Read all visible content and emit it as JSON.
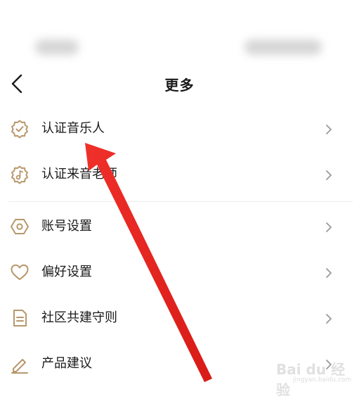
{
  "header": {
    "title": "更多"
  },
  "menu": {
    "items": [
      {
        "label": "认证音乐人",
        "icon": "verified-badge-icon"
      },
      {
        "label": "认证来音老师",
        "icon": "music-badge-icon"
      },
      {
        "label": "账号设置",
        "icon": "hexagon-settings-icon"
      },
      {
        "label": "偏好设置",
        "icon": "heart-icon"
      },
      {
        "label": "社区共建守则",
        "icon": "document-icon"
      },
      {
        "label": "产品建议",
        "icon": "pencil-icon"
      }
    ]
  },
  "watermark": {
    "brand": "Bai du 经验",
    "url": "jingyan.baidu.com"
  },
  "colors": {
    "icon_gold": "#b8976a",
    "annotation_arrow": "#e8231e"
  }
}
